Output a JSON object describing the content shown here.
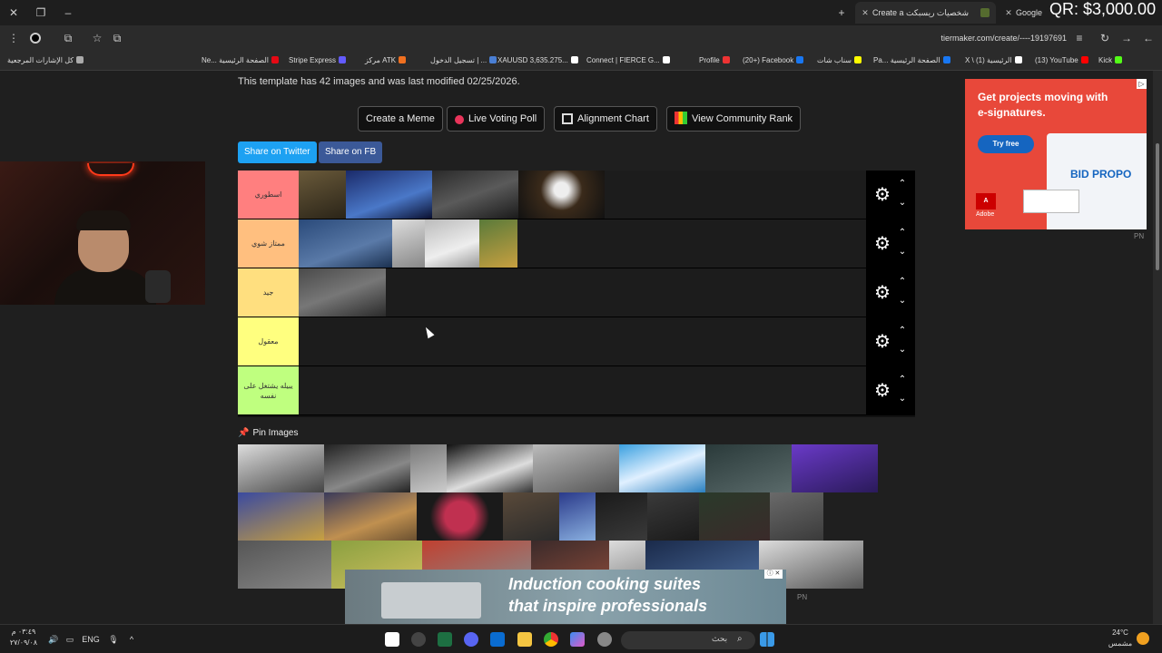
{
  "overlay": {
    "qr_text": "QR: $3,000.00"
  },
  "tabs": [
    {
      "label": "Google",
      "close": "✕",
      "active": false
    },
    {
      "label": "Create a تحميل شخصيات ريسبكت",
      "close": "✕",
      "active": true
    }
  ],
  "window_controls": {
    "close": "✕",
    "restore": "❐",
    "minimize": "–",
    "new_tab": "+"
  },
  "toolbar": {
    "url": "tiermaker.com/create/----19197691",
    "back": "←",
    "forward": "→",
    "reload": "↻",
    "menu": "⋮",
    "extensions": "⧉",
    "star": "☆"
  },
  "bookmarks": [
    {
      "label": "Kick",
      "color": "#53fc18"
    },
    {
      "label": "(13) YouTube",
      "color": "#ff0000"
    },
    {
      "label": "X \\ (1) الرئيسية",
      "color": "#ffffff"
    },
    {
      "label": "Pa... الصفحة الرئيسية",
      "color": "#1877f2"
    },
    {
      "label": "سناب شات",
      "color": "#fffc00"
    },
    {
      "label": "(20+) Facebook",
      "color": "#1877f2"
    },
    {
      "label": "Profile",
      "color": "#e33"
    },
    {
      "label": "Connect | FIERCE G...",
      "color": "#ffffff"
    },
    {
      "label": "XAUUSD 3,635.275...",
      "color": "#ffffff"
    },
    {
      "label": "تسجيل الدخول | ...",
      "color": "#4a7fd4"
    },
    {
      "label": "مركز ATK",
      "color": "#f07020"
    },
    {
      "label": "Stripe Express",
      "color": "#635bff"
    },
    {
      "label": "Ne... الصفحة الرئيسية",
      "color": "#e50914"
    },
    {
      "label": "كل الإشارات المرجعية",
      "color": "#aaa"
    }
  ],
  "page": {
    "info_text": "This template has 42 images and was last modified 02/25/2026.",
    "buttons": {
      "create_meme": "Create a Meme",
      "live_voting": "Live Voting Poll",
      "alignment_chart": "Alignment Chart",
      "community_rank": "View Community Rank"
    },
    "share": {
      "twitter": "Share on Twitter",
      "fb": "Share on FB"
    },
    "tiers": [
      {
        "label": "اسطوري",
        "color": "#ff7f7f",
        "images": 4
      },
      {
        "label": "ممتاز شوي",
        "color": "#ffbf7f",
        "images": 4
      },
      {
        "label": "جيد",
        "color": "#ffdf7f",
        "images": 1
      },
      {
        "label": "معقول",
        "color": "#ffff7f",
        "images": 0
      },
      {
        "label": "يبيله يشتغل على نفسه",
        "color": "#bfff7f",
        "images": 0
      }
    ],
    "pin_label": "Pin Images",
    "gear_icon": "⚙",
    "up_icon": "⌃",
    "down_icon": "⌄"
  },
  "ads": {
    "side": {
      "headline": "Get projects moving with e-signatures.",
      "cta": "Try free",
      "brand_text": "BID PROPO",
      "adobe": "Adobe",
      "pn": "PN"
    },
    "bottom": {
      "line1": "Induction cooking suites",
      "line2": "that inspire professionals",
      "close": "ⓘ ✕",
      "pn": "PN"
    }
  },
  "taskbar": {
    "time": "٠٣:٤٩ م",
    "date": "٢٧/٠٩/٠٨",
    "lang": "ENG",
    "search_placeholder": "بحث",
    "temp": "24°C",
    "weather": "مشمس"
  }
}
